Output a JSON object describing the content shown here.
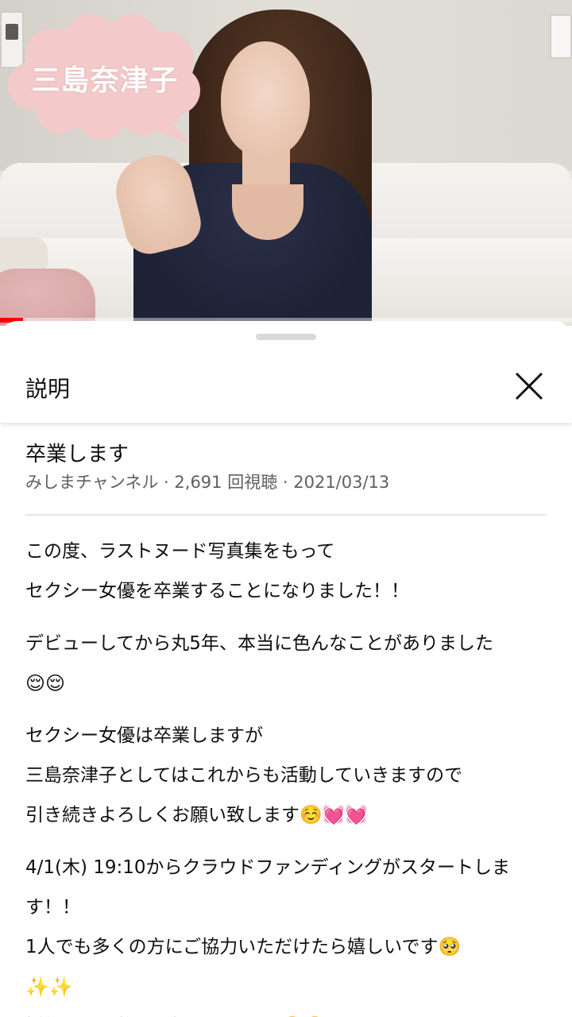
{
  "video": {
    "overlay_name": "三島奈津子",
    "progress_fraction": 0.04,
    "colors": {
      "bubble": "#f3c9c9",
      "progress": "#ff0000"
    }
  },
  "sheet": {
    "title": "説明",
    "close_icon": "close-x-icon"
  },
  "video_info": {
    "title": "卒業します",
    "channel": "みしまチャンネル",
    "views": "2,691 回視聴",
    "date": "2021/03/13",
    "separator": " · "
  },
  "description": {
    "paragraphs": [
      [
        "この度、ラストヌード写真集をもって",
        "セクシー女優を卒業することになりました！！"
      ],
      [
        "デビューしてから丸5年、本当に色んなことがありました",
        "😌😌"
      ],
      [
        "セクシー女優は卒業しますが",
        "三島奈津子としてはこれからも活動していきますので",
        "引き続きよろしくお願い致します☺️💓💓"
      ],
      [
        "4/1(木) 19:10からクラウドファンディングがスタートしま",
        "す！！",
        "1人でも多くの方にご協力いただけたら嬉しいです🥺",
        "✨✨",
        "詳細はまた後日お知らせします🥺🥺"
      ]
    ]
  }
}
